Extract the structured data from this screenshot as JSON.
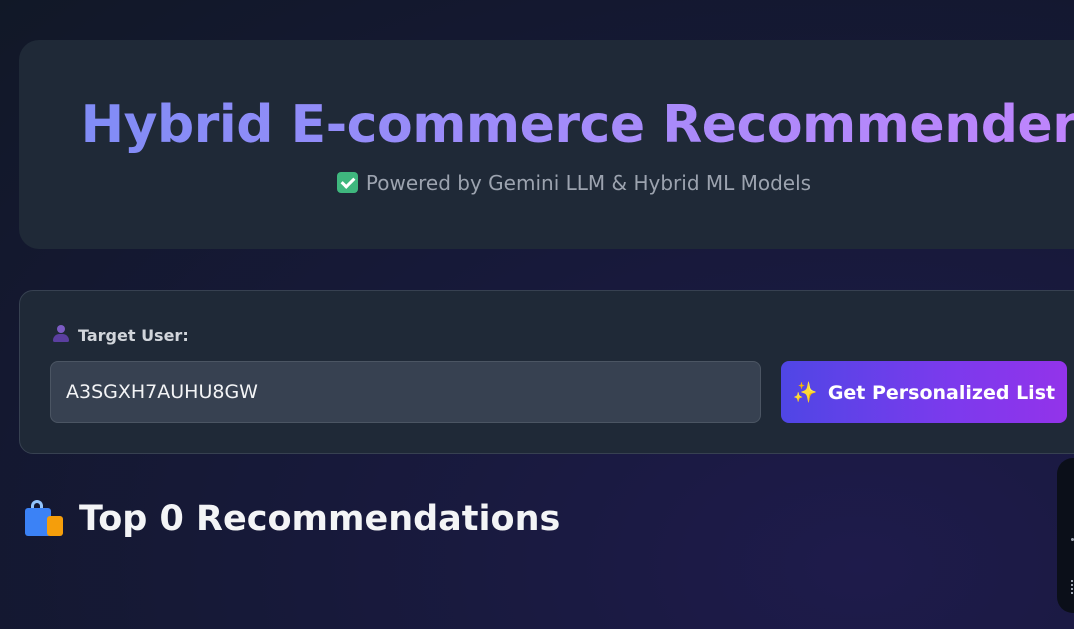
{
  "hero": {
    "title": "Hybrid E-commerce Recommender",
    "subtitle": "Powered by Gemini LLM & Hybrid ML Models",
    "subtitle_icon": "check-mark-icon"
  },
  "user_form": {
    "label": "Target User:",
    "label_icon": "user-silhouette-icon",
    "input_value": "A3SGXH7AUHU8GW",
    "button_label": "Get Personalized List",
    "button_icon": "sparkles-icon"
  },
  "recommendations": {
    "title": "Top 0 Recommendations",
    "icon": "shopping-bags-icon"
  },
  "colors": {
    "background": "#151833",
    "card": "#1f2937",
    "input": "#374151",
    "button_start": "#4f46e5",
    "button_end": "#9333ea",
    "title_start": "#7f8cf6",
    "title_end": "#c084fc",
    "check": "#3fb77e"
  }
}
